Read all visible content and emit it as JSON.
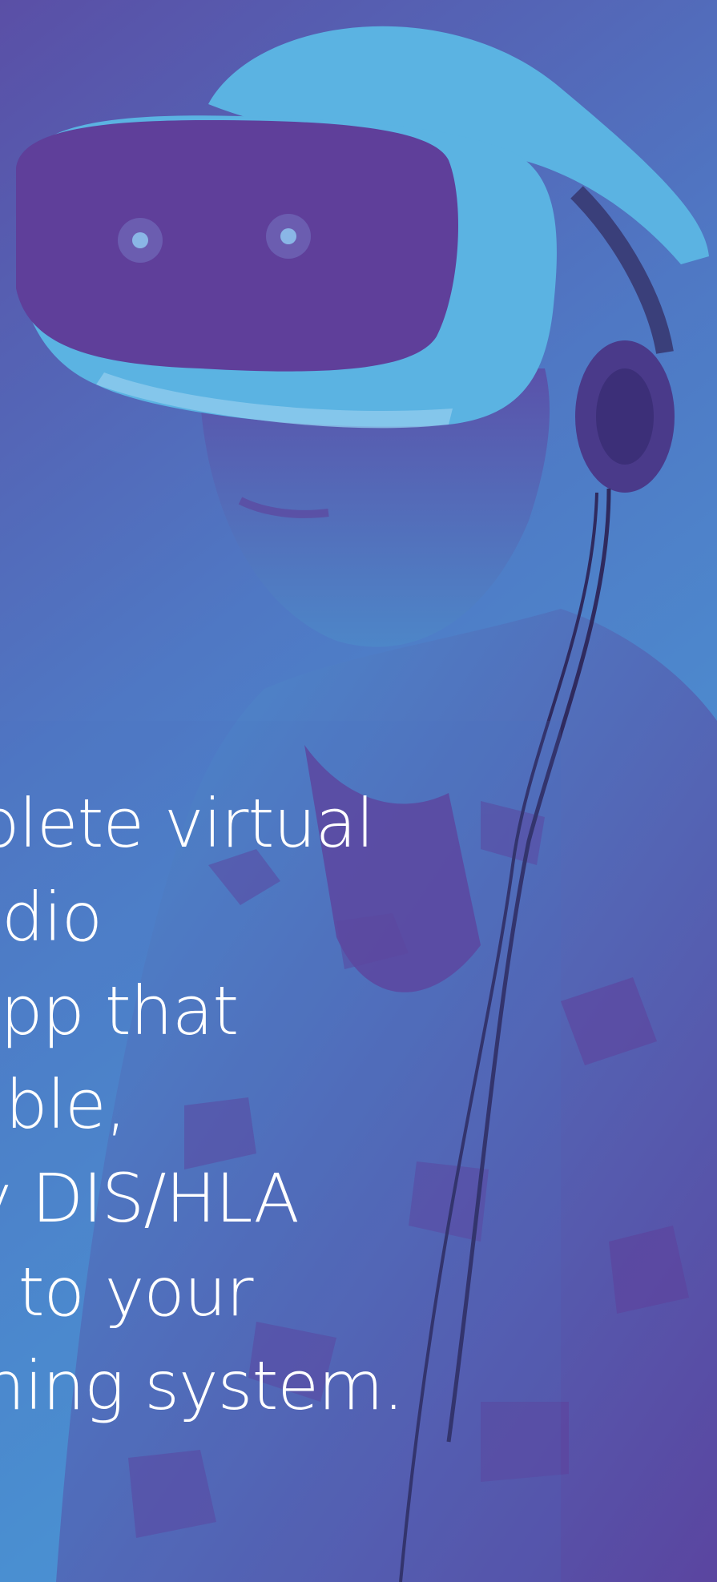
{
  "hero": {
    "lines": [
      "omplete virtual",
      "d radio",
      "nt app that",
      "ortable,",
      "play DIS/HLA",
      "tion to your",
      "training system."
    ]
  },
  "image": {
    "subject": "vr-headset-trainee",
    "icons": [
      "vr-headset-icon",
      "headphones-icon"
    ]
  },
  "colors": {
    "duotone_purple": "#5f3f9a",
    "duotone_blue": "#4aa0dc",
    "headset_light": "#5bb3e2",
    "text": "#ffffff"
  }
}
